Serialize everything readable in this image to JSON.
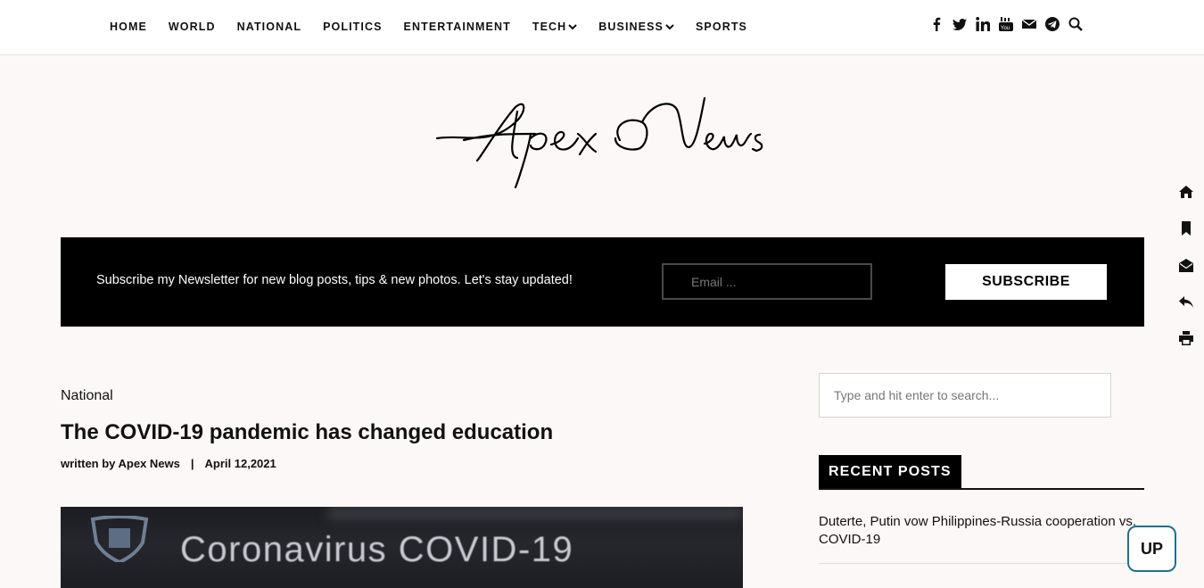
{
  "nav": {
    "items": [
      {
        "label": "HOME",
        "dropdown": false
      },
      {
        "label": "WORLD",
        "dropdown": false
      },
      {
        "label": "NATIONAL",
        "dropdown": false
      },
      {
        "label": "POLITICS",
        "dropdown": false
      },
      {
        "label": "ENTERTAINMENT",
        "dropdown": false
      },
      {
        "label": "TECH",
        "dropdown": true
      },
      {
        "label": "BUSINESS",
        "dropdown": true
      },
      {
        "label": "SPORTS",
        "dropdown": false
      }
    ],
    "social_icons": [
      "facebook-icon",
      "twitter-icon",
      "linkedin-icon",
      "youtube-icon",
      "envelope-icon",
      "telegram-icon",
      "search-icon"
    ]
  },
  "logo": {
    "text": "Apex News"
  },
  "newsletter": {
    "text": "Subscribe my Newsletter for new blog posts, tips & new photos. Let's stay updated!",
    "email_placeholder": "Email ...",
    "button_label": "SUBSCRIBE"
  },
  "side_icons": [
    "home-icon",
    "bookmark-icon",
    "envelope-open-icon",
    "reply-icon",
    "print-icon"
  ],
  "article": {
    "category": "National",
    "title": "The COVID-19 pandemic has changed education",
    "author": "written by Apex News",
    "separator": "|",
    "date": "April 12,2021",
    "hero_text": "Coronavirus COVID-19"
  },
  "sidebar": {
    "search_placeholder": "Type and hit enter to search...",
    "recent_heading": "RECENT POSTS",
    "recent_posts": [
      "Duterte, Putin vow Philippines-Russia cooperation vs. COVID-19"
    ]
  },
  "up_button": "UP",
  "colors": {
    "page_bg": "#fcf8f7",
    "newsletter_bg": "#000000",
    "up_border": "#1f6f8b"
  }
}
